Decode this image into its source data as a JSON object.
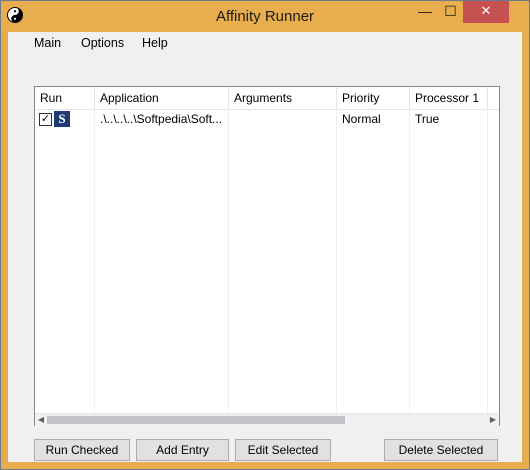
{
  "window": {
    "title": "Affinity Runner",
    "minimize_glyph": "—",
    "maximize_glyph": "☐",
    "close_glyph": "✕"
  },
  "menu": {
    "items": [
      "Main",
      "Options",
      "Help"
    ]
  },
  "list": {
    "columns": [
      "Run",
      "Application",
      "Arguments",
      "Priority",
      "Processor 1"
    ],
    "rows": [
      {
        "run_checked": true,
        "check_glyph": "✓",
        "icon_letter": "S",
        "application": ".\\..\\..\\..\\Softpedia\\Soft...",
        "arguments": "",
        "priority": "Normal",
        "processor1": "True"
      }
    ],
    "scroll_left_glyph": "◀",
    "scroll_right_glyph": "▶"
  },
  "buttons": {
    "run_checked": "Run Checked",
    "add_entry": "Add Entry",
    "edit_selected": "Edit Selected",
    "delete_selected": "Delete Selected"
  },
  "colors": {
    "titlebar": "#e8ad4c",
    "close_button": "#c75050",
    "app_icon_bg": "#1f3b73"
  },
  "icons": {
    "app_icon": "yin-yang-icon",
    "row_icon": "softpedia-s-icon"
  }
}
